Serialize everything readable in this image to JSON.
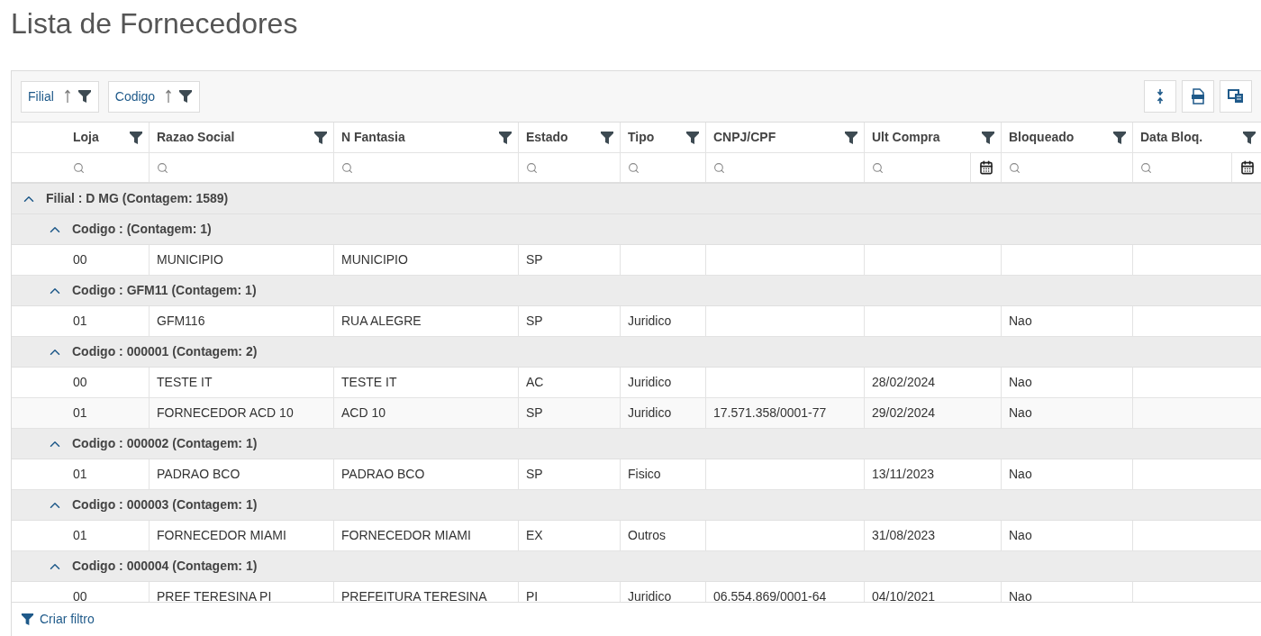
{
  "title": "Lista de Fornecedores",
  "group_chips": [
    {
      "label": "Filial"
    },
    {
      "label": "Codigo"
    }
  ],
  "columns": [
    {
      "label": "Loja",
      "kind": "text"
    },
    {
      "label": "Razao Social",
      "kind": "text"
    },
    {
      "label": "N Fantasia",
      "kind": "text"
    },
    {
      "label": "Estado",
      "kind": "text"
    },
    {
      "label": "Tipo",
      "kind": "text"
    },
    {
      "label": "CNPJ/CPF",
      "kind": "text"
    },
    {
      "label": "Ult Compra",
      "kind": "date"
    },
    {
      "label": "Bloqueado",
      "kind": "text"
    },
    {
      "label": "Data Bloq.",
      "kind": "date"
    }
  ],
  "groups": [
    {
      "label": "Filial : D MG (Contagem: 1589)",
      "expanded": true,
      "children": [
        {
          "label": "Codigo : (Contagem: 1)",
          "expanded": true,
          "rows": [
            {
              "cells": [
                "00",
                "MUNICIPIO",
                "MUNICIPIO",
                "SP"
              ]
            }
          ]
        },
        {
          "label": "Codigo : GFM11 (Contagem: 1)",
          "expanded": true,
          "rows": [
            {
              "cells": [
                "01",
                "GFM116",
                "RUA ALEGRE",
                "SP",
                "Juridico",
                "",
                "",
                "Nao"
              ]
            }
          ]
        },
        {
          "label": "Codigo : 000001 (Contagem: 2)",
          "expanded": true,
          "rows": [
            {
              "cells": [
                "00",
                "TESTE IT",
                "TESTE IT",
                "AC",
                "Juridico",
                "",
                "28/02/2024",
                "Nao"
              ]
            },
            {
              "cells": [
                "01",
                "FORNECEDOR ACD 10",
                "ACD 10",
                "SP",
                "Juridico",
                "17.571.358/0001-77",
                "29/02/2024",
                "Nao"
              ]
            }
          ]
        },
        {
          "label": "Codigo : 000002 (Contagem: 1)",
          "expanded": true,
          "rows": [
            {
              "cells": [
                "01",
                "PADRAO BCO",
                "PADRAO BCO",
                "SP",
                "Fisico",
                "",
                "13/11/2023",
                "Nao"
              ]
            }
          ]
        },
        {
          "label": "Codigo : 000003 (Contagem: 1)",
          "expanded": true,
          "rows": [
            {
              "cells": [
                "01",
                "FORNECEDOR MIAMI",
                "FORNECEDOR MIAMI",
                "EX",
                "Outros",
                "",
                "31/08/2023",
                "Nao"
              ]
            }
          ]
        },
        {
          "label": "Codigo : 000004 (Contagem: 1)",
          "expanded": true,
          "rows": [
            {
              "cells": [
                "00",
                "PREF TERESINA PI",
                "PREFEITURA TERESINA",
                "PI",
                "Juridico",
                "06.554.869/0001-64",
                "04/10/2021",
                "Nao"
              ]
            }
          ]
        }
      ]
    }
  ],
  "footer": {
    "label": "Criar filtro"
  }
}
